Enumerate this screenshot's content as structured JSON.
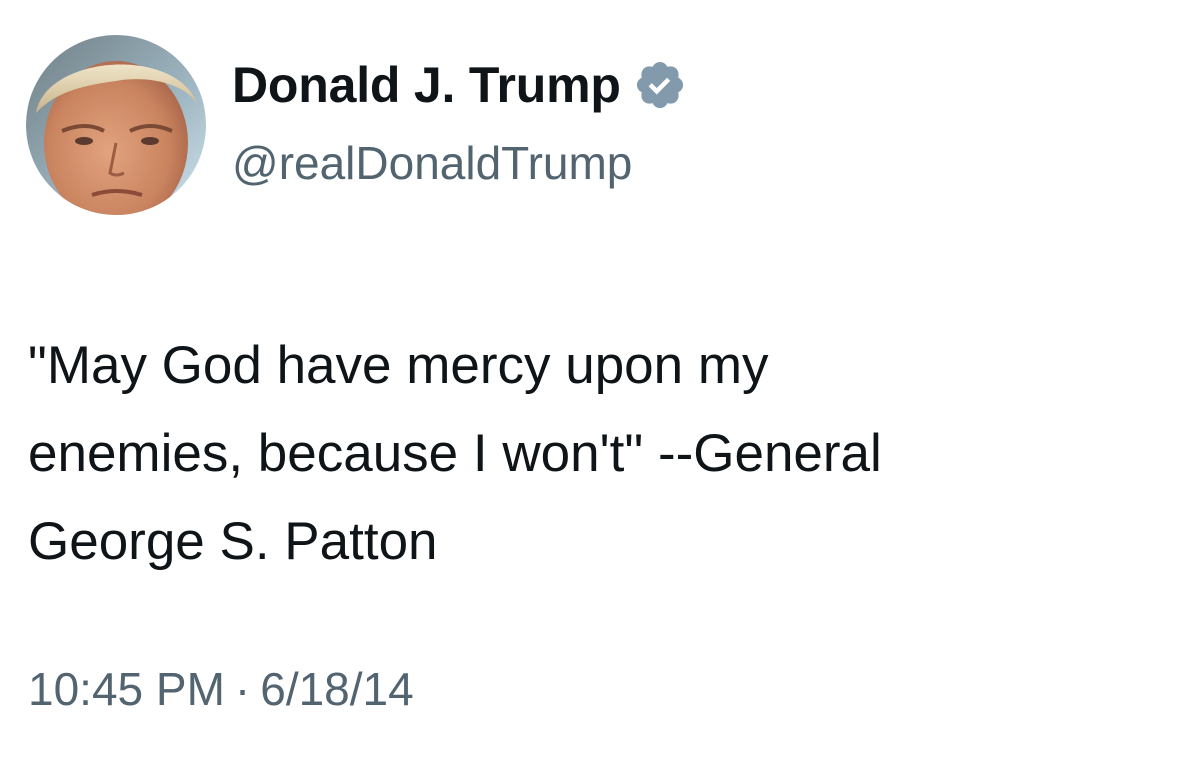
{
  "author": {
    "display_name": "Donald J. Trump",
    "handle": "@realDonaldTrump",
    "verified_badge_color": "#829aab",
    "avatar_icon": "profile-photo"
  },
  "tweet": {
    "text_lines": [
      "\"May God have mercy upon my",
      "enemies, because I won't\" --General",
      "George S. Patton"
    ],
    "time": "10:45 PM",
    "separator": "·",
    "date": "6/18/14"
  },
  "colors": {
    "primary_text": "#0f1419",
    "secondary_text": "#536471",
    "background": "#ffffff"
  }
}
